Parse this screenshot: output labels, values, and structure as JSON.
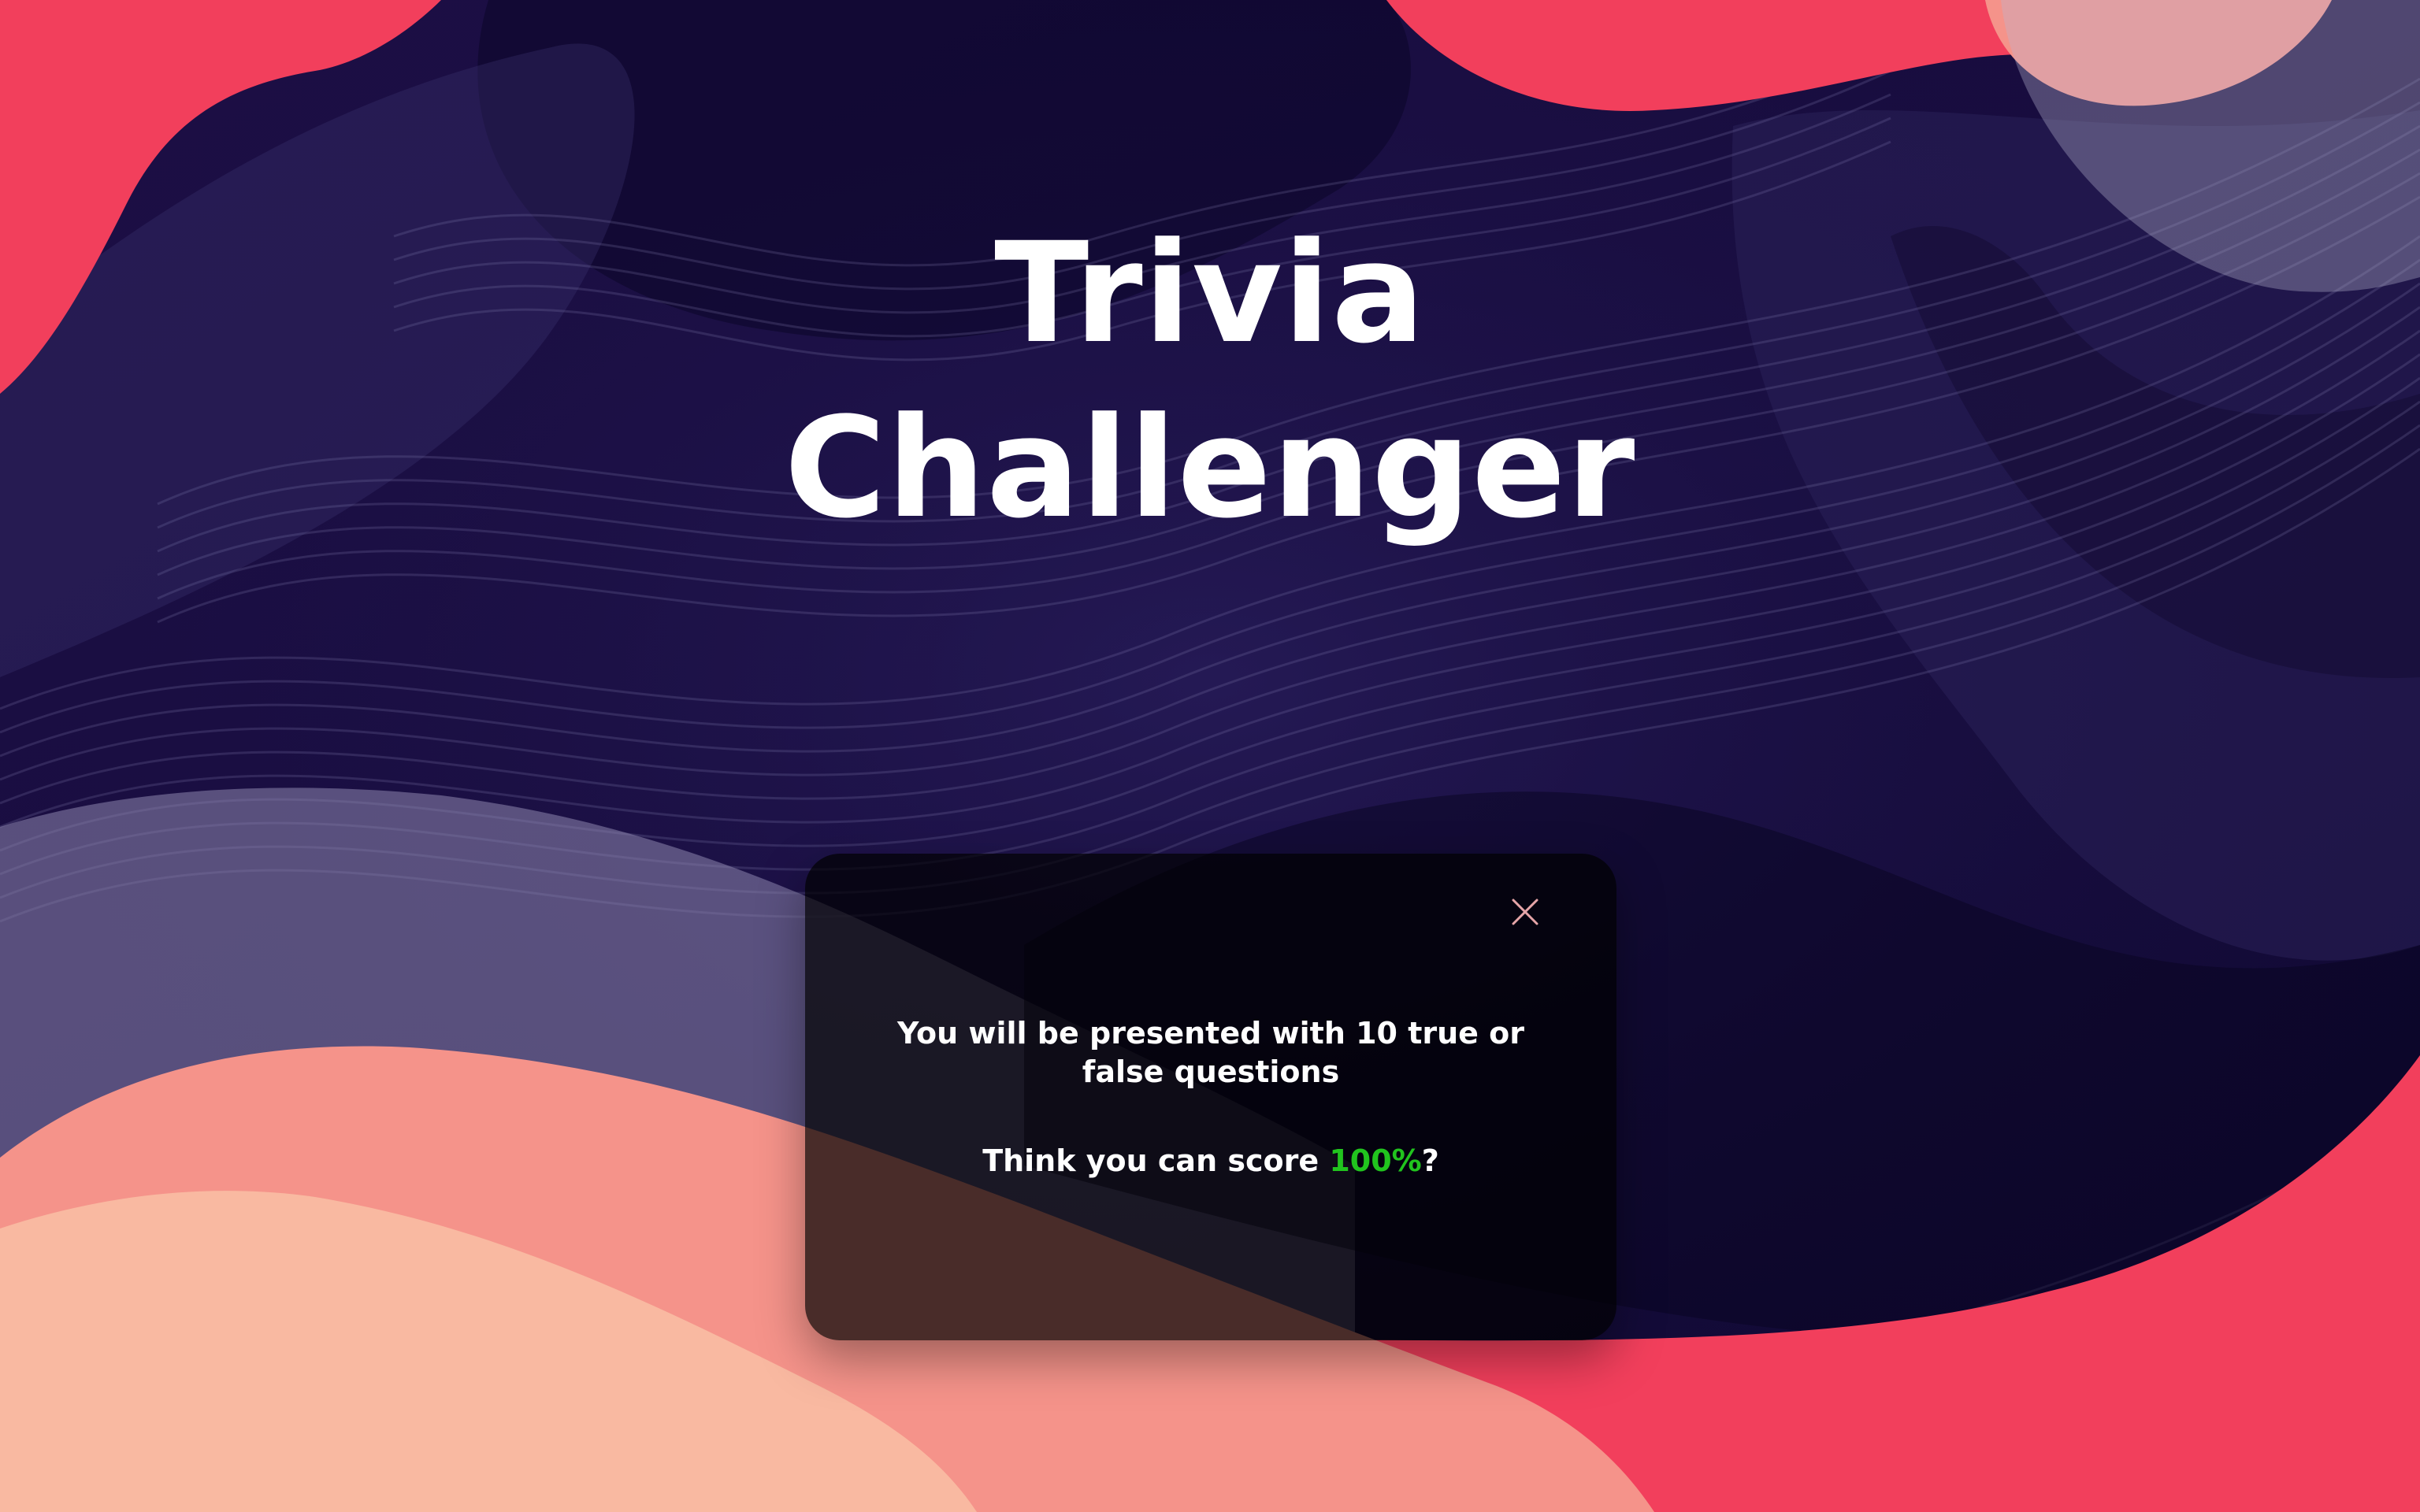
{
  "title": {
    "line1": "Trivia",
    "line2": "Challenger"
  },
  "modal": {
    "message": "You will be presented with 10 true or false questions",
    "prompt_before": "Think you can score ",
    "prompt_highlight": "100%",
    "prompt_after": "?",
    "close_icon": "close-icon"
  },
  "colors": {
    "background_dark": "#150b3a",
    "coral": "#f23f5c",
    "peach": "#f5938a",
    "light_peach": "#f9b9a1",
    "highlight_green": "#21c41e"
  }
}
